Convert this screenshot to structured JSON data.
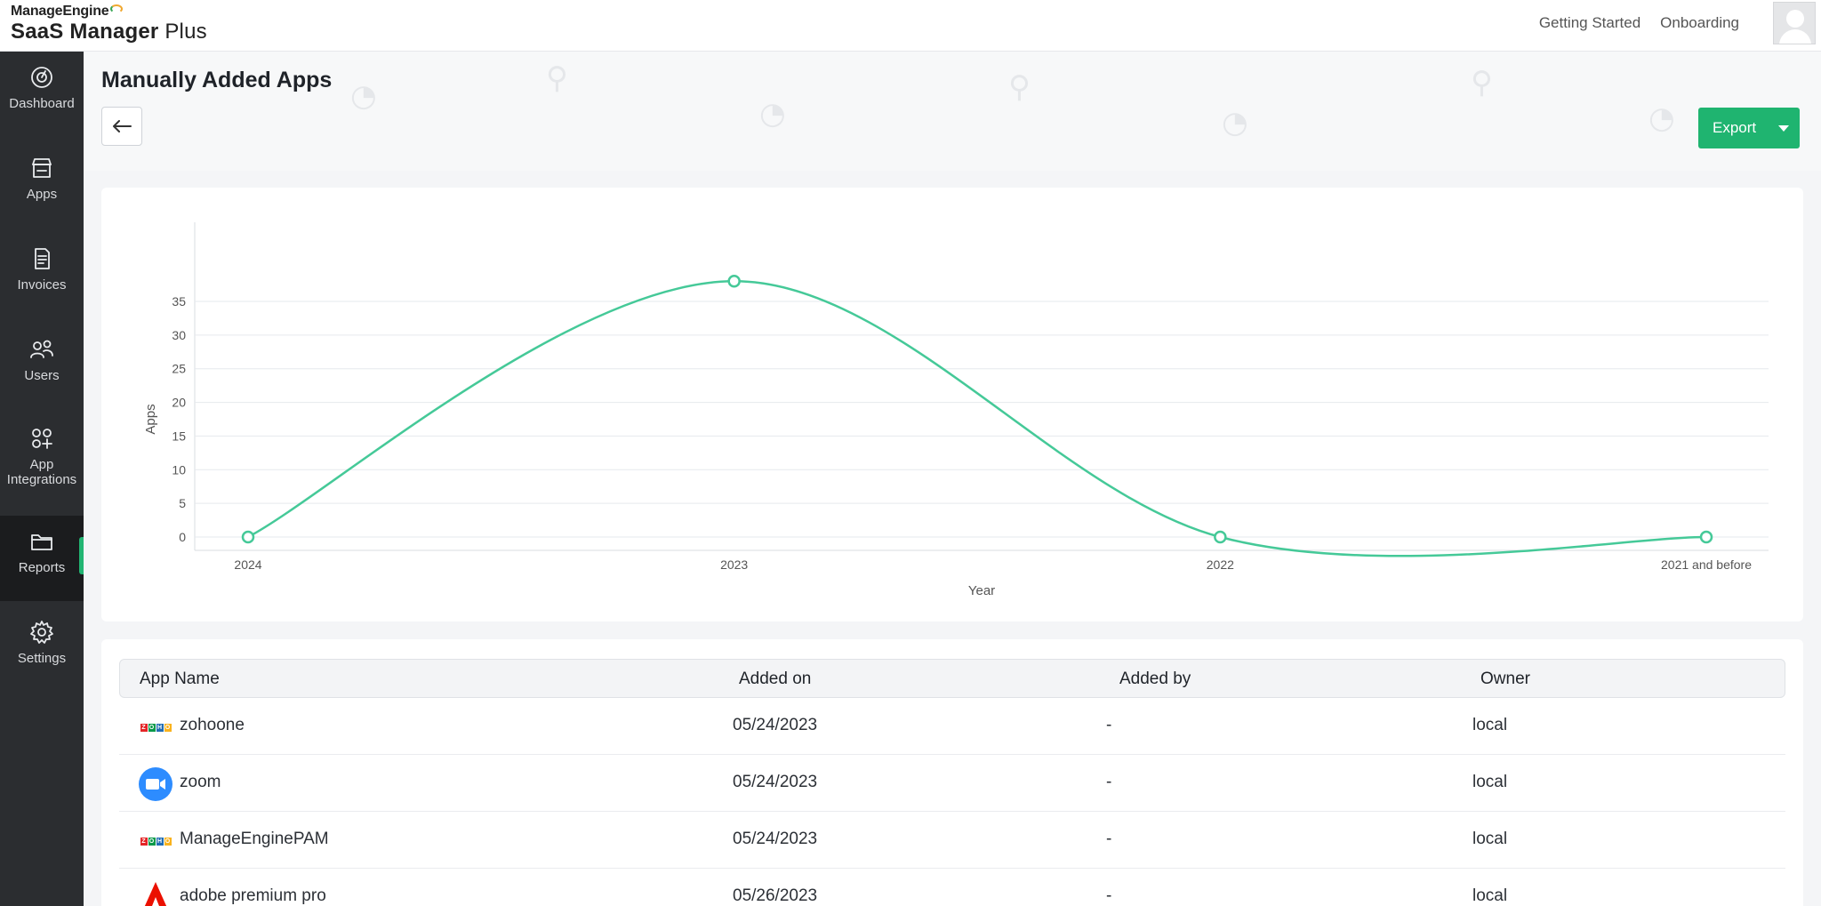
{
  "brand": {
    "vendor": "ManageEngine",
    "product_bold": "SaaS Manager",
    "product_rest": " Plus"
  },
  "topnav": {
    "links": [
      "Getting Started",
      "Onboarding"
    ]
  },
  "sidebar": {
    "items": [
      {
        "label": "Dashboard",
        "icon": "dashboard-icon",
        "active": false
      },
      {
        "label": "Apps",
        "icon": "store-icon",
        "active": false
      },
      {
        "label": "Invoices",
        "icon": "invoice-icon",
        "active": false
      },
      {
        "label": "Users",
        "icon": "users-icon",
        "active": false
      },
      {
        "label": "App Integrations",
        "icon": "integrations-icon",
        "active": false
      },
      {
        "label": "Reports",
        "icon": "folder-icon",
        "active": true
      },
      {
        "label": "Settings",
        "icon": "gear-icon",
        "active": false
      }
    ]
  },
  "page": {
    "title": "Manually Added Apps",
    "export_label": "Export",
    "accent": "#1fb470"
  },
  "chart_data": {
    "type": "line",
    "categories": [
      "2024",
      "2023",
      "2022",
      "2021 and before"
    ],
    "values": [
      0,
      38,
      0,
      0
    ],
    "xlabel": "Year",
    "ylabel": "Apps",
    "ylim": [
      0,
      35
    ],
    "yticks": [
      0,
      5,
      10,
      15,
      20,
      25,
      30,
      35
    ],
    "grid": true,
    "line_color": "#45c998",
    "curve": "smooth"
  },
  "table": {
    "headers": {
      "name": "App Name",
      "added_on": "Added on",
      "added_by": "Added by",
      "owner": "Owner"
    },
    "rows": [
      {
        "name": "zohoone",
        "icon": "zoho-icon",
        "added_on": "05/24/2023",
        "added_by": "-",
        "owner": "local"
      },
      {
        "name": "zoom",
        "icon": "zoom-icon",
        "added_on": "05/24/2023",
        "added_by": "-",
        "owner": "local"
      },
      {
        "name": "ManageEnginePAM",
        "icon": "zoho-icon",
        "added_on": "05/24/2023",
        "added_by": "-",
        "owner": "local"
      },
      {
        "name": "adobe premium pro",
        "icon": "adobe-icon",
        "added_on": "05/26/2023",
        "added_by": "-",
        "owner": "local"
      }
    ]
  }
}
